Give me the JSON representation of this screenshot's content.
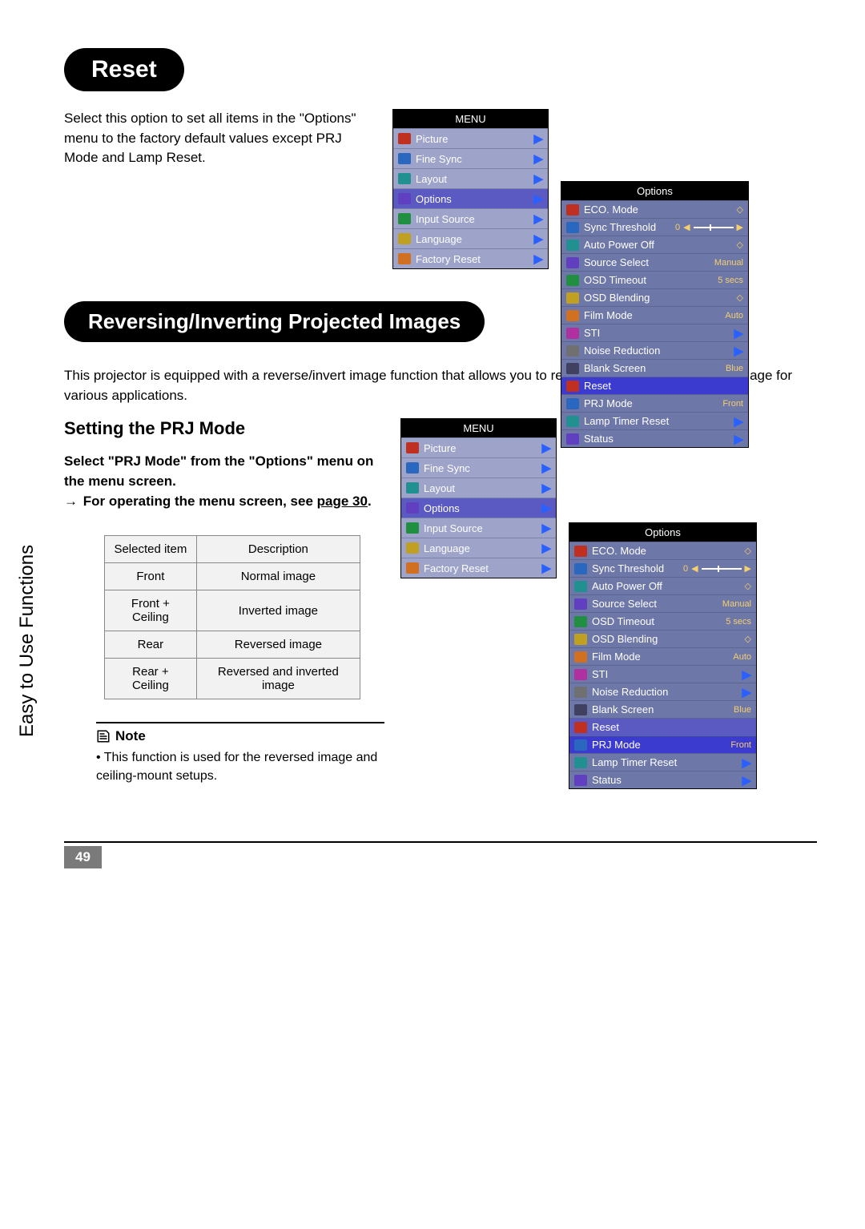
{
  "sidebar": "Easy to Use Functions",
  "s1": {
    "head": "Reset",
    "body": "Select this option to set all items in the \"Options\" menu to the factory default values except PRJ Mode and Lamp Reset."
  },
  "s2": {
    "head": "Reversing/Inverting Projected Images",
    "intro": "This projector is equipped with a reverse/invert image function that allows you to reverse or invert the projected image for various applications.",
    "subhead": "Setting the PRJ Mode",
    "inst1": "Select \"PRJ Mode\" from the \"Options\" menu on the menu screen.",
    "inst2a": "For operating the menu screen, see ",
    "inst2b": "page 30",
    "inst2c": ".",
    "table": {
      "h1": "Selected item",
      "h2": "Description",
      "r1c1": "Front",
      "r1c2": "Normal image",
      "r2c1": "Front + Ceiling",
      "r2c2": "Inverted image",
      "r3c1": "Rear",
      "r3c2": "Reversed image",
      "r4c1": "Rear + Ceiling",
      "r4c2": "Reversed and inverted image"
    },
    "note_head": "Note",
    "note_body": "This function is used for the reversed image and ceiling-mount setups."
  },
  "menu": {
    "title": "MENU",
    "items": [
      "Picture",
      "Fine Sync",
      "Layout",
      "Options",
      "Input Source",
      "Language",
      "Factory Reset"
    ]
  },
  "opts": {
    "title": "Options",
    "rows": [
      {
        "label": "ECO. Mode",
        "val": "◇",
        "type": "v"
      },
      {
        "label": "Sync Threshold",
        "val": "0",
        "type": "slider"
      },
      {
        "label": "Auto Power Off",
        "val": "◇",
        "type": "v"
      },
      {
        "label": "Source Select",
        "val": "Manual",
        "type": "v"
      },
      {
        "label": "OSD Timeout",
        "val": "5 secs",
        "type": "v"
      },
      {
        "label": "OSD Blending",
        "val": "◇",
        "type": "v"
      },
      {
        "label": "Film Mode",
        "val": "Auto",
        "type": "v"
      },
      {
        "label": "STI",
        "val": "▶",
        "type": "a"
      },
      {
        "label": "Noise Reduction",
        "val": "▶",
        "type": "a"
      },
      {
        "label": "Blank Screen",
        "val": "Blue",
        "type": "v"
      },
      {
        "label": "Reset",
        "val": "",
        "type": "sect"
      },
      {
        "label": "PRJ Mode",
        "val": "Front",
        "type": "v"
      },
      {
        "label": "Lamp Timer Reset",
        "val": "▶",
        "type": "a"
      },
      {
        "label": "Status",
        "val": "▶",
        "type": "a"
      }
    ],
    "hl1": 10,
    "hl2": 11
  },
  "page": "49"
}
